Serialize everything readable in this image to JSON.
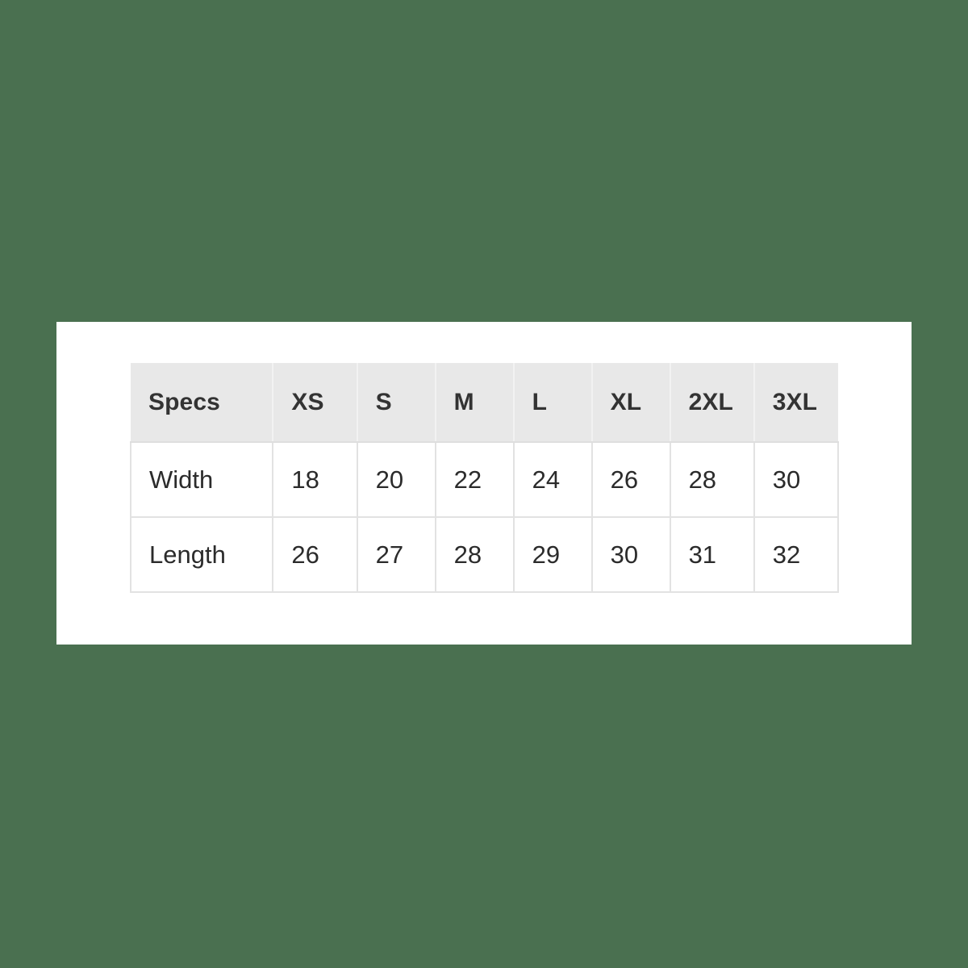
{
  "page": {
    "background_color": "#4a7050",
    "card_background_color": "#ffffff"
  },
  "table": {
    "name": "size-specs-table",
    "header_background_color": "#e8e8e8",
    "header_text_color": "#333333",
    "body_text_color": "#2b2b2b",
    "grid_line_color": "#e2e2e2",
    "row_label_header": "Specs",
    "size_columns": [
      "XS",
      "S",
      "M",
      "L",
      "XL",
      "2XL",
      "3XL"
    ],
    "rows": [
      {
        "label": "Width",
        "values": [
          "18",
          "20",
          "22",
          "24",
          "26",
          "28",
          "30"
        ]
      },
      {
        "label": "Length",
        "values": [
          "26",
          "27",
          "28",
          "29",
          "30",
          "31",
          "32"
        ]
      }
    ]
  },
  "chart_data": {
    "type": "table",
    "title": "",
    "categories": [
      "XS",
      "S",
      "M",
      "L",
      "XL",
      "2XL",
      "3XL"
    ],
    "series": [
      {
        "name": "Width",
        "values": [
          18,
          20,
          22,
          24,
          26,
          28,
          30
        ]
      },
      {
        "name": "Length",
        "values": [
          26,
          27,
          28,
          29,
          30,
          31,
          32
        ]
      }
    ],
    "xlabel": "Specs",
    "ylabel": "",
    "legend": [
      "Width",
      "Length"
    ]
  }
}
